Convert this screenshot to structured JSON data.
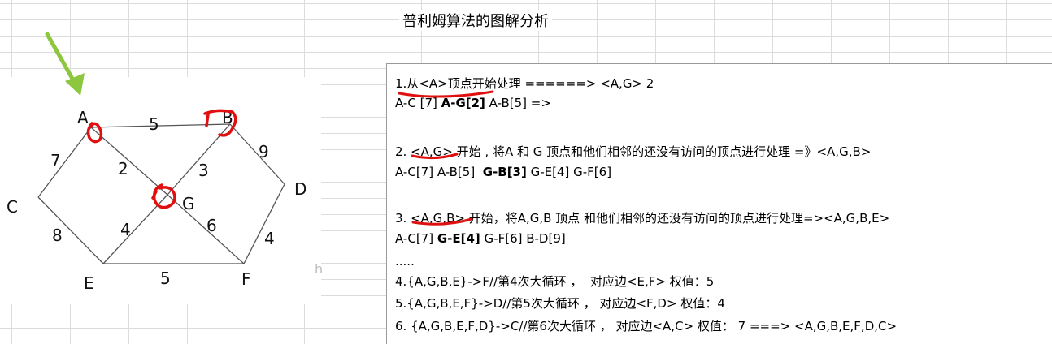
{
  "title": "普利姆算法的图解分析",
  "graph": {
    "nodes": [
      {
        "id": "A",
        "label": "A"
      },
      {
        "id": "B",
        "label": "B"
      },
      {
        "id": "C",
        "label": "C"
      },
      {
        "id": "D",
        "label": "D"
      },
      {
        "id": "E",
        "label": "E"
      },
      {
        "id": "F",
        "label": "F"
      },
      {
        "id": "G",
        "label": "G"
      }
    ],
    "edges": [
      {
        "from": "A",
        "to": "B",
        "weight": "5"
      },
      {
        "from": "A",
        "to": "C",
        "weight": "7"
      },
      {
        "from": "A",
        "to": "G",
        "weight": "2"
      },
      {
        "from": "B",
        "to": "G",
        "weight": "3"
      },
      {
        "from": "B",
        "to": "D",
        "weight": "9"
      },
      {
        "from": "C",
        "to": "E",
        "weight": "8"
      },
      {
        "from": "E",
        "to": "G",
        "weight": "4"
      },
      {
        "from": "G",
        "to": "F",
        "weight": "6"
      },
      {
        "from": "E",
        "to": "F",
        "weight": "5"
      },
      {
        "from": "D",
        "to": "F",
        "weight": "4"
      }
    ],
    "accent_arrow_color": "#8dc63f",
    "highlight_color": "#e01010"
  },
  "stray_text": "h",
  "steps": {
    "s1a": "1.从<A>顶点开始处理 ======> <A,G> 2",
    "s1b_1": "A-C [7] ",
    "s1b_2": "A-G[2]",
    "s1b_3": " A-B[5] =>",
    "s2a": "2. <A,G> 开始 , 将A 和 G 顶点和他们相邻的还没有访问的顶点进行处理 =》<A,G,B>",
    "s2b_1": "A-C[7] A-B[5]  ",
    "s2b_2": "G-B[3]",
    "s2b_3": " G-E[4] G-F[6]",
    "s3a": "3. <A,G,B> 开始，将A,G,B 顶点 和他们相邻的还没有访问的顶点进行处理=><A,G,B,E>",
    "s3b_1": "A-C[7] ",
    "s3b_2": "G-E[4]",
    "s3b_3": " G-F[6] B-D[9]",
    "dots": ".....",
    "s4": "4.{A,G,B,E}->F//第4次大循环 ，  对应边<E,F> 权值：5",
    "s5": "5.{A,G,B,E,F}->D//第5次大循环 ， 对应边<F,D> 权值：4",
    "s6": "6. {A,G,B,E,F,D}->C//第6次大循环 ， 对应边<A,C> 权值： 7 ===> <A,G,B,E,F,D,C>"
  }
}
